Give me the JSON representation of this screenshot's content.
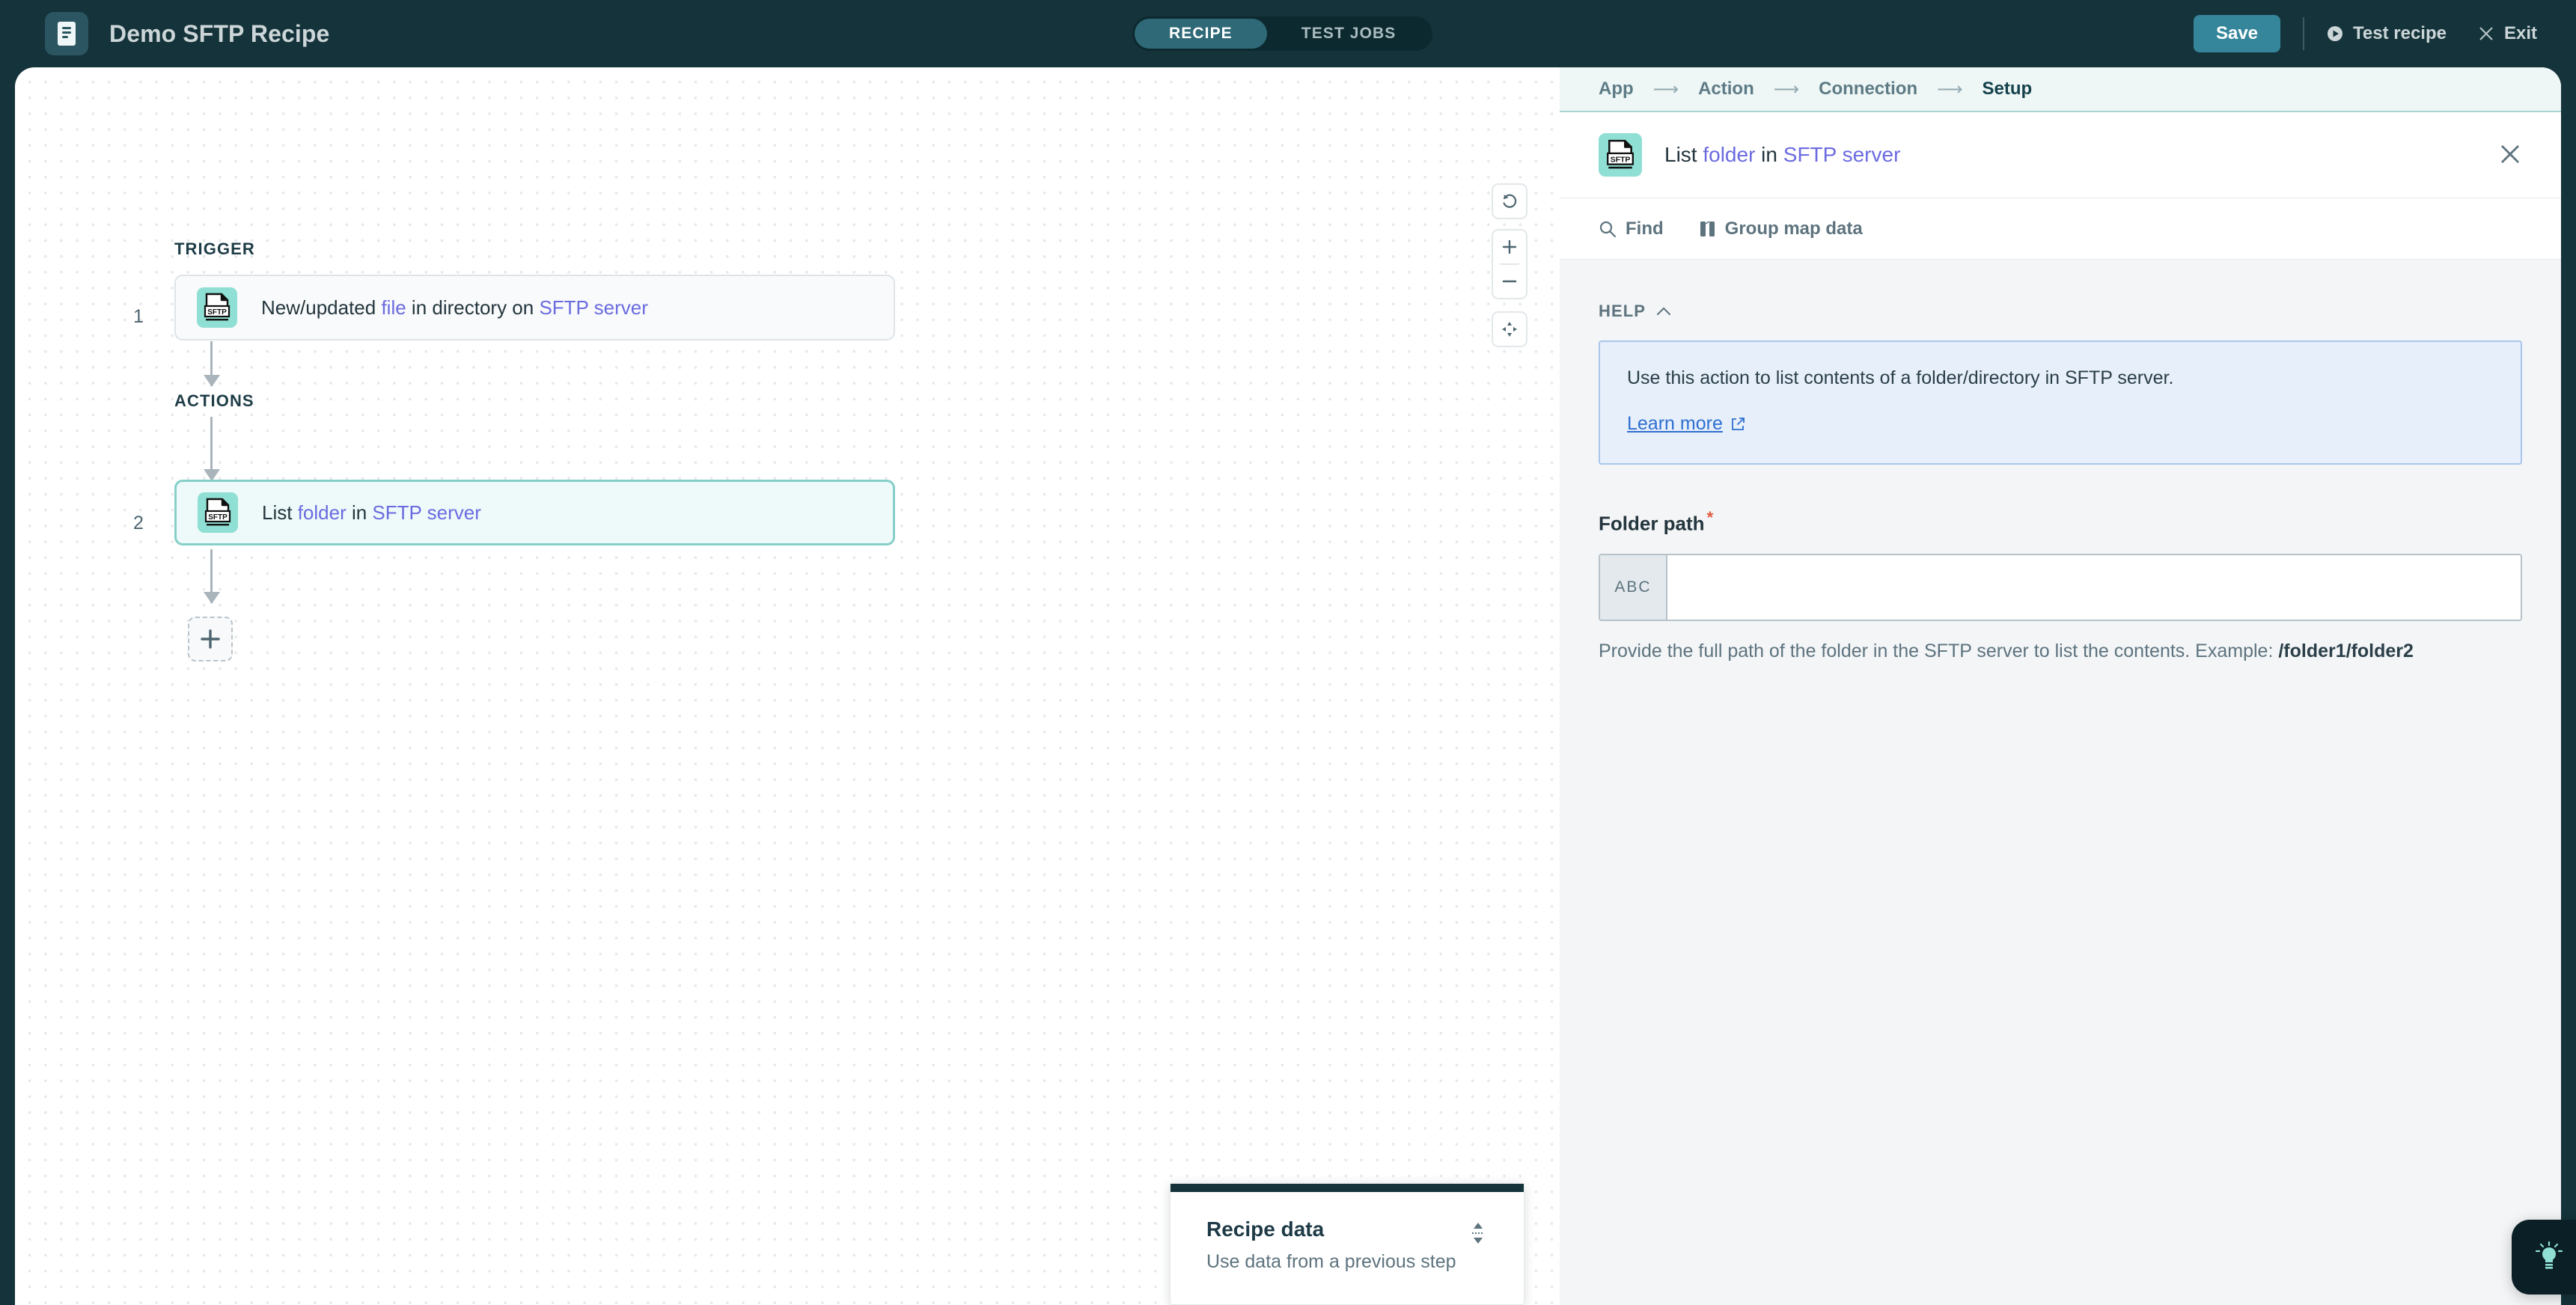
{
  "topbar": {
    "logo_icon": "recipe-document-icon",
    "title": "Demo SFTP Recipe",
    "tabs": [
      {
        "label": "RECIPE",
        "active": true
      },
      {
        "label": "TEST JOBS",
        "active": false
      }
    ],
    "save_label": "Save",
    "test_recipe_label": "Test recipe",
    "test_recipe_icon": "play-circle-icon",
    "exit_label": "Exit",
    "exit_icon": "close-x-icon"
  },
  "canvas": {
    "trigger_section_label": "TRIGGER",
    "actions_section_label": "ACTIONS",
    "steps": [
      {
        "number": "1",
        "icon": "sftp-file-icon",
        "text_parts": [
          {
            "t": "New/updated ",
            "link": false
          },
          {
            "t": "file",
            "link": true
          },
          {
            "t": " in directory on ",
            "link": false
          },
          {
            "t": "SFTP server",
            "link": true
          }
        ],
        "selected": false
      },
      {
        "number": "2",
        "icon": "sftp-file-icon",
        "text_parts": [
          {
            "t": "List ",
            "link": false
          },
          {
            "t": "folder",
            "link": true
          },
          {
            "t": " in ",
            "link": false
          },
          {
            "t": "SFTP server",
            "link": true
          }
        ],
        "selected": true
      }
    ],
    "add_step_icon": "plus-icon",
    "controls": [
      {
        "icon": "reset-undo-icon"
      },
      {
        "icon": "zoom-in-plus-icon"
      },
      {
        "icon": "zoom-out-minus-icon"
      },
      {
        "icon": "pan-move-icon"
      }
    ]
  },
  "recipe_data_card": {
    "title": "Recipe data",
    "subtitle": "Use data from a previous step",
    "resize_icon": "drag-resize-vertical-icon"
  },
  "panel": {
    "breadcrumbs": [
      {
        "label": "App",
        "active": false
      },
      {
        "label": "Action",
        "active": false
      },
      {
        "label": "Connection",
        "active": false
      },
      {
        "label": "Setup",
        "active": true
      }
    ],
    "breadcrumb_separator": "⟶",
    "header": {
      "icon": "sftp-file-icon",
      "title_parts": [
        {
          "t": "List ",
          "link": false
        },
        {
          "t": "folder",
          "link": true
        },
        {
          "t": " in ",
          "link": false
        },
        {
          "t": "SFTP server",
          "link": true
        }
      ],
      "close_icon": "close-x-icon"
    },
    "tools": [
      {
        "label": "Find",
        "icon": "search-icon"
      },
      {
        "label": "Group map data",
        "icon": "group-columns-icon"
      }
    ],
    "help": {
      "section_label": "HELP",
      "collapse_icon": "chevron-up-icon",
      "text": "Use this action to list contents of a folder/directory in SFTP server.",
      "link_label": "Learn more",
      "link_icon": "external-link-icon"
    },
    "folder_path": {
      "label": "Folder path",
      "required_marker": "*",
      "datatype_badge": "ABC",
      "value": "",
      "placeholder": "",
      "hint_prefix": "Provide the full path of the folder in the SFTP server to list the contents. Example: ",
      "hint_example": "/folder1/folder2"
    }
  },
  "fab": {
    "icon": "lightbulb-idea-icon"
  },
  "colors": {
    "topbar_bg": "#15333a",
    "accent_teal": "#35869b",
    "icon_mint": "#8fdfd4",
    "selected_block_bg": "#edfaf9",
    "selected_block_border": "#86cfc9",
    "link_purple": "#6b6be0",
    "help_box_bg": "#e6effa",
    "help_box_border": "#a9c6ea",
    "help_link": "#2f6fd0",
    "required_star": "#e0593b",
    "panel_bg": "#f3f5f7"
  }
}
